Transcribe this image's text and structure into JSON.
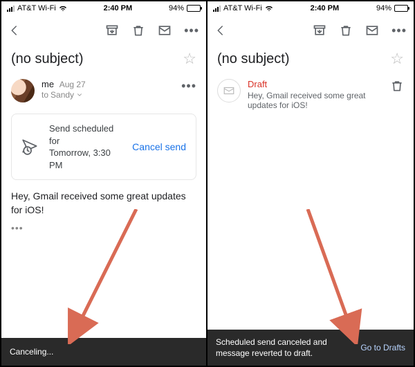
{
  "statusbar": {
    "carrier": "AT&T Wi-Fi",
    "time": "2:40 PM",
    "battery_pct": "94%"
  },
  "left": {
    "subject": "(no subject)",
    "sender": "me",
    "date": "Aug 27",
    "to_prefix": "to",
    "to_name": "Sandy",
    "scheduled_line1": "Send scheduled for",
    "scheduled_line2": "Tomorrow, 3:30 PM",
    "cancel_label": "Cancel send",
    "body": "Hey, Gmail received some great updates for iOS!",
    "body_more": "•••",
    "toast": "Canceling..."
  },
  "right": {
    "subject": "(no subject)",
    "draft_label": "Draft",
    "preview": "Hey, Gmail received some great updates for iOS!",
    "toast_msg": "Scheduled send canceled and message reverted to draft.",
    "toast_action": "Go to Drafts"
  },
  "icons": {
    "back": "back-icon",
    "archive": "archive-icon",
    "trash": "trash-icon",
    "mail": "mail-icon",
    "overflow": "overflow-icon",
    "star": "star-icon",
    "chevron": "chevron-down-icon",
    "schedule": "send-scheduled-icon",
    "envelope": "envelope-icon"
  }
}
